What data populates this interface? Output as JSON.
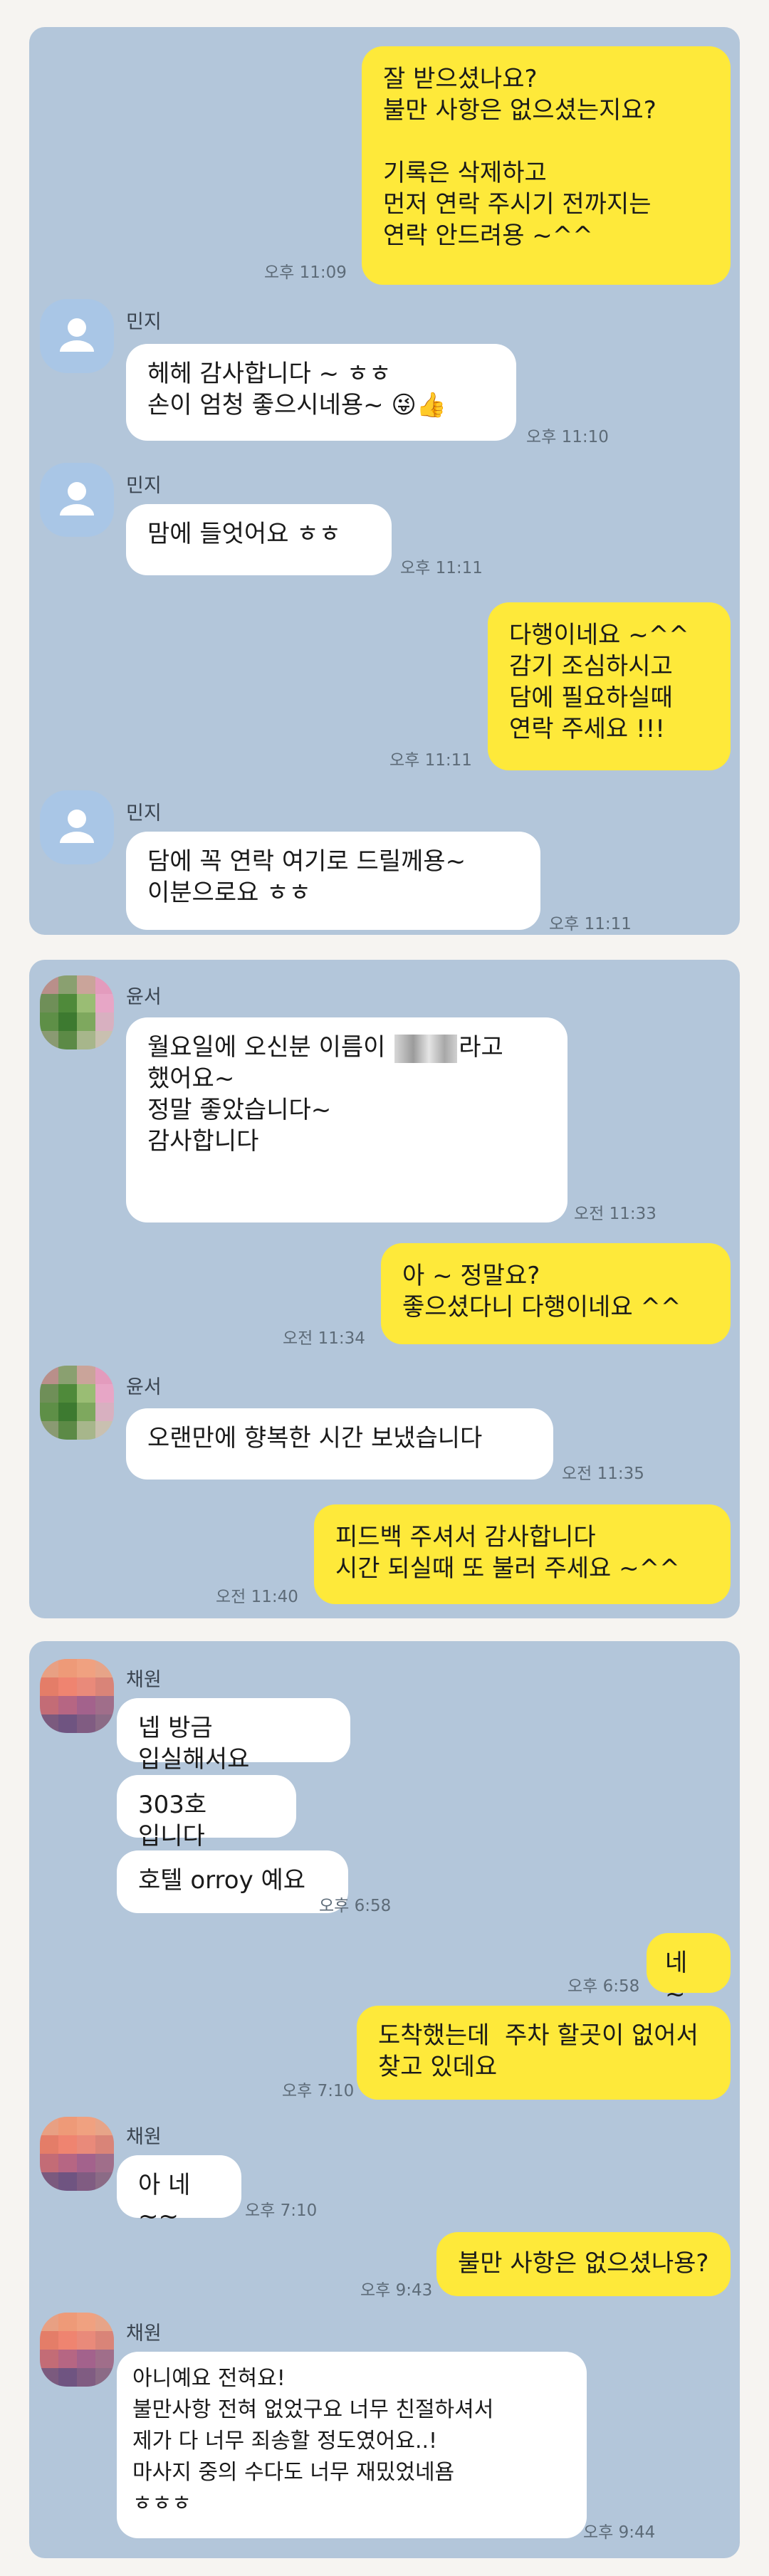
{
  "colors": {
    "page_bg": "#f6f4f1",
    "chat_bg": "#b3c6da",
    "my_bubble": "#fee93a",
    "their_bubble": "#ffffff",
    "default_avatar": "#a9c6e6"
  },
  "panel1": {
    "m1": {
      "text": "잘 받으셨나요?\n불만 사항은 없으셨는지요?\n\n기록은 삭제하고\n먼저 연락 주시기 전까지는\n연락 안드려용 ~^^",
      "time": "오후 11:09"
    },
    "m2": {
      "sender": "민지",
      "text": "헤헤 감사합니다 ~ ㅎㅎ\n손이 엄청 좋으시네용~ 😜👍",
      "time": "오후 11:10"
    },
    "m3": {
      "sender": "민지",
      "text": "맘에 들엇어요 ㅎㅎ",
      "time": "오후 11:11"
    },
    "m4": {
      "text": "다행이네요 ~^^\n감기 조심하시고\n담에 필요하실때\n연락 주세요 !!!",
      "time": "오후 11:11"
    },
    "m5": {
      "sender": "민지",
      "text": "담에 꼭 연락 여기로 드릴께용~\n이분으로요 ㅎㅎ",
      "time": "오후 11:11"
    }
  },
  "panel2": {
    "m1": {
      "sender": "윤서",
      "text_before": "월요일에 오신분 이름이 ",
      "text_after": "라고\n했어요~\n정말 좋았습니다~\n감사합니다",
      "time": "오전 11:33"
    },
    "m2": {
      "text": "아 ~ 정말요?\n좋으셨다니 다행이네요 ^^",
      "time": "오전 11:34"
    },
    "m3": {
      "sender": "윤서",
      "text": "오랜만에 향복한 시간 보냈습니다",
      "time": "오전 11:35"
    },
    "m4": {
      "text": "피드백 주셔서 감사합니다\n시간 되실때 또 불러 주세요 ~^^",
      "time": "오전 11:40"
    }
  },
  "panel3": {
    "m1": {
      "sender": "채원",
      "text": "넵 방금 입실해서요"
    },
    "m2": {
      "text": "303호 입니다"
    },
    "m3": {
      "text": "호텔 orroy 예요",
      "time": "오후 6:58"
    },
    "m4": {
      "text": "네 ~",
      "time": "오후 6:58"
    },
    "m5": {
      "text": "도착했는데  주차 할곳이 없어서\n찾고 있데요",
      "time": "오후 7:10"
    },
    "m6": {
      "sender": "채원",
      "text": "아 네~~",
      "time": "오후 7:10"
    },
    "m7": {
      "text": "불만 사항은 없으셨나용?",
      "time": "오후 9:43"
    },
    "m8": {
      "sender": "채원",
      "text": "아니예요 전혀요!\n불만사항 전혀 없었구요 너무 친절하셔서\n제가 다 너무 죄송할 정도였어요..!\n마사지 중의 수다도 너무 재밌었네욤\nㅎㅎㅎ",
      "time": "오후 9:44"
    }
  }
}
